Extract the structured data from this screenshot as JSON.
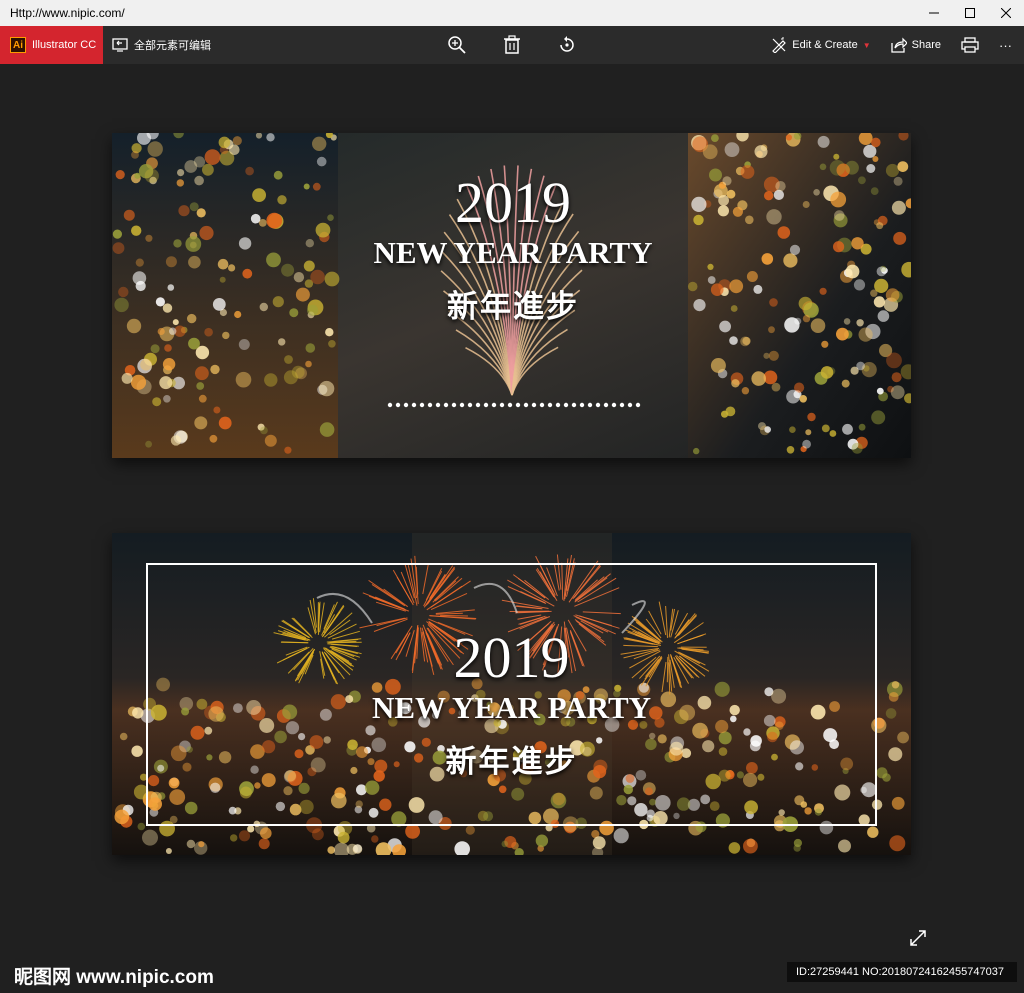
{
  "window": {
    "title": "Http://www.nipic.com/"
  },
  "toolbar": {
    "app_badge": "Illustrator CC",
    "ai_logo": "Ai",
    "edit_all": "全部元素可编辑",
    "edit_create": "Edit & Create",
    "share": "Share",
    "more": "···"
  },
  "banner1": {
    "year": "2019",
    "headline": "NEW YEAR PARTY",
    "subline": "新年進步"
  },
  "banner2": {
    "year": "2019",
    "headline": "NEW YEAR PARTY",
    "subline": "新年進步"
  },
  "watermark": {
    "logo": "昵图网 www.nipic.com",
    "id": "ID:27259441 NO:20180724162455747037"
  },
  "colors": {
    "accent": "#d4252e",
    "bg": "#202020",
    "toolbar": "#2b2b2b"
  }
}
